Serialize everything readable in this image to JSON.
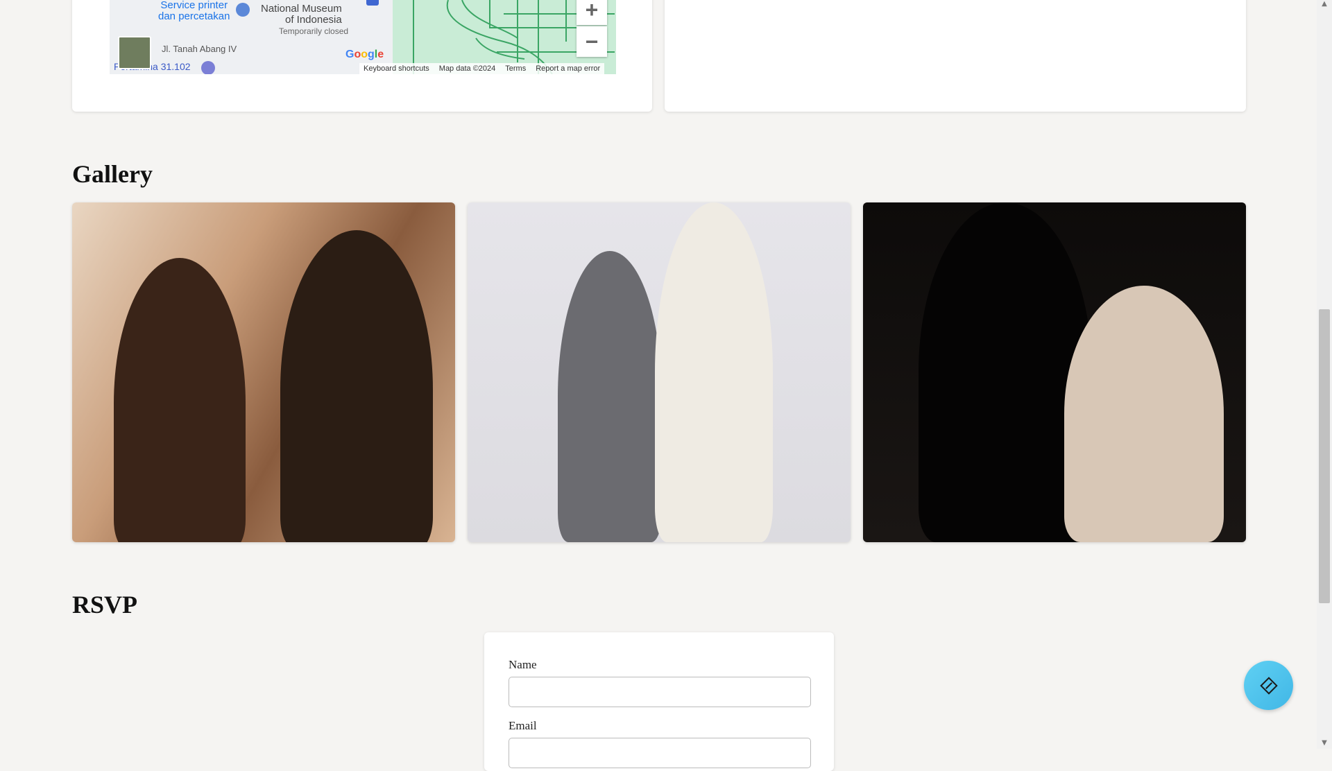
{
  "map": {
    "labels": {
      "printer": "Service printer\ndan percetakan",
      "museum": "National Museum\nof Indonesia",
      "closed": "Temporarily closed",
      "street": "Jl. Tanah Abang IV",
      "pertamina": "Pertamina 31.102",
      "google": "Google"
    },
    "zoom_in": "+",
    "zoom_out": "−",
    "attribution": {
      "shortcuts": "Keyboard shortcuts",
      "map_data": "Map data ©2024",
      "terms": "Terms",
      "report": "Report a map error"
    }
  },
  "gallery": {
    "title": "Gallery",
    "photos": [
      "photo-1",
      "photo-2",
      "photo-3"
    ]
  },
  "rsvp": {
    "title": "RSVP",
    "name_label": "Name",
    "email_label": "Email",
    "name_value": "",
    "email_value": ""
  },
  "colors": {
    "background": "#f5f4f2",
    "fab": "#4fc4ee",
    "google_blue": "#4285f4"
  },
  "icons": {
    "fab": "diamond-icon"
  }
}
